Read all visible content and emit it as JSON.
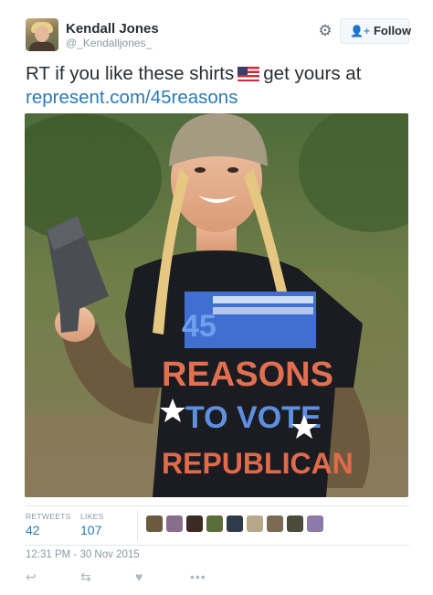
{
  "user": {
    "name": "Kendall Jones",
    "handle": "@_Kendalljones_"
  },
  "header": {
    "settings_icon": "gear-icon",
    "follow_icon": "add-user-icon",
    "follow_label": "Follow"
  },
  "tweet": {
    "text_before": "RT if you like these shirts",
    "emoji": "us-flag",
    "text_after": "get yours at",
    "link": "represent.com/45reasons"
  },
  "photo": {
    "shirt_lines": [
      "45",
      "REASONS",
      "TO VOTE",
      "REPUBLICAN"
    ]
  },
  "stats": {
    "retweets_label": "RETWEETS",
    "retweets": "42",
    "likes_label": "LIKES",
    "likes": "107"
  },
  "likers": [
    {
      "color": "#6b5a3e"
    },
    {
      "color": "#8a6d8c"
    },
    {
      "color": "#3e2a25"
    },
    {
      "color": "#5a6e3a"
    },
    {
      "color": "#2f3b4a"
    },
    {
      "color": "#b7a88a"
    },
    {
      "color": "#7d6a52"
    },
    {
      "color": "#4b4b3c"
    },
    {
      "color": "#8c7aa8"
    }
  ],
  "timestamp": "12:31 PM - 30 Nov 2015",
  "actions": {
    "reply_icon": "reply-icon",
    "retweet_icon": "retweet-icon",
    "like_icon": "heart-icon",
    "more_icon": "more-icon"
  },
  "colors": {
    "link": "#2b7bb9",
    "text": "#292f33",
    "muted": "#8899a6"
  }
}
